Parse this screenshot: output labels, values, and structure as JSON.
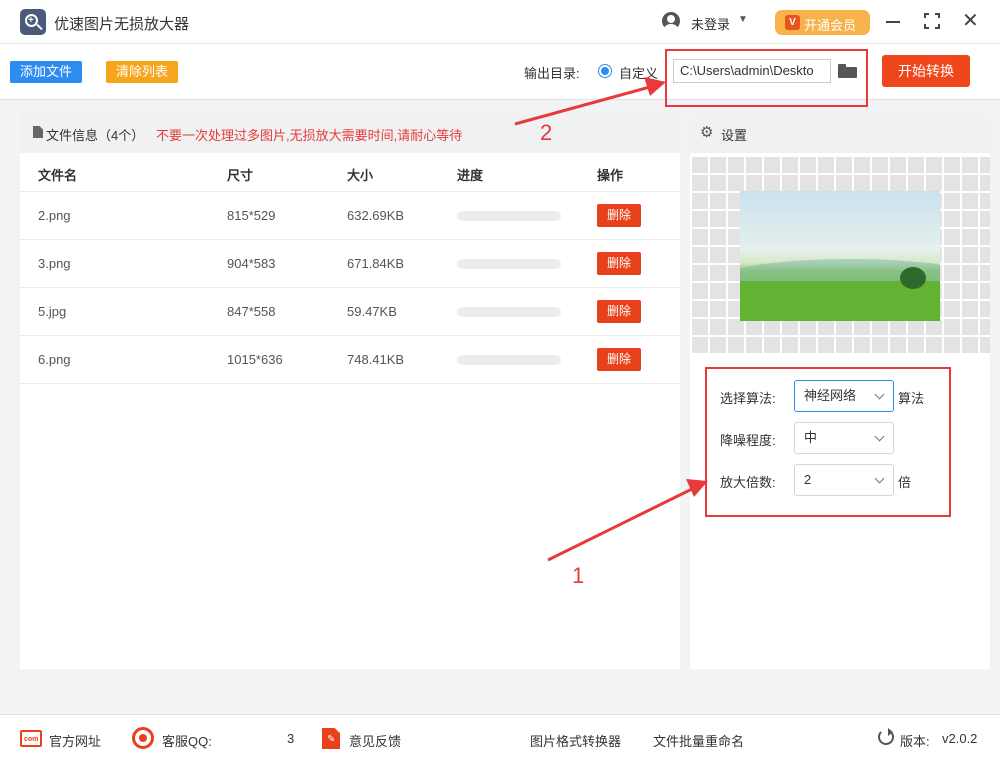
{
  "app": {
    "title": "优速图片无损放大器"
  },
  "header": {
    "login_label": "未登录",
    "vip_label": "开通会员",
    "vip_icon_text": "V"
  },
  "toolbar": {
    "add_files_label": "添加文件",
    "clear_list_label": "清除列表",
    "output_dir_label": "输出目录:",
    "custom_label": "自定义",
    "output_path": "C:\\Users\\admin\\Deskto",
    "start_label": "开始转换"
  },
  "file_panel": {
    "title": "文件信息（4个）",
    "warning": "不要一次处理过多图片,无损放大需要时间,请耐心等待",
    "columns": {
      "name": "文件名",
      "size": "尺寸",
      "filesize": "大小",
      "progress": "进度",
      "action": "操作"
    },
    "files": [
      {
        "name": "2.png",
        "dimensions": "815*529",
        "filesize": "632.69KB",
        "progress": 0,
        "delete_label": "删除"
      },
      {
        "name": "3.png",
        "dimensions": "904*583",
        "filesize": "671.84KB",
        "progress": 0,
        "delete_label": "删除"
      },
      {
        "name": "5.jpg",
        "dimensions": "847*558",
        "filesize": "59.47KB",
        "progress": 0,
        "delete_label": "删除"
      },
      {
        "name": "6.png",
        "dimensions": "1015*636",
        "filesize": "748.41KB",
        "progress": 0,
        "delete_label": "删除"
      }
    ]
  },
  "settings": {
    "title": "设置",
    "algorithm_label": "选择算法:",
    "algorithm_value": "神经网络",
    "algorithm_suffix": "算法",
    "denoise_label": "降噪程度:",
    "denoise_value": "中",
    "scale_label": "放大倍数:",
    "scale_value": "2",
    "scale_suffix": "倍"
  },
  "annotations": {
    "arrow1_label": "1",
    "arrow2_label": "2"
  },
  "footer": {
    "website_label": "官方网址",
    "website_icon_text": "com",
    "qq_label": "客服QQ:",
    "qq_partial": "3",
    "feedback_label": "意见反馈",
    "format_converter_label": "图片格式转换器",
    "batch_rename_label": "文件批量重命名",
    "version_label": "版本:",
    "version_value": "v2.0.2"
  },
  "colors": {
    "primary_blue": "#2d8cf0",
    "accent_orange": "#f7a51c",
    "start_red": "#f0461c",
    "warning_red": "#e83a3a",
    "vip_gold": "#f7b24b"
  }
}
